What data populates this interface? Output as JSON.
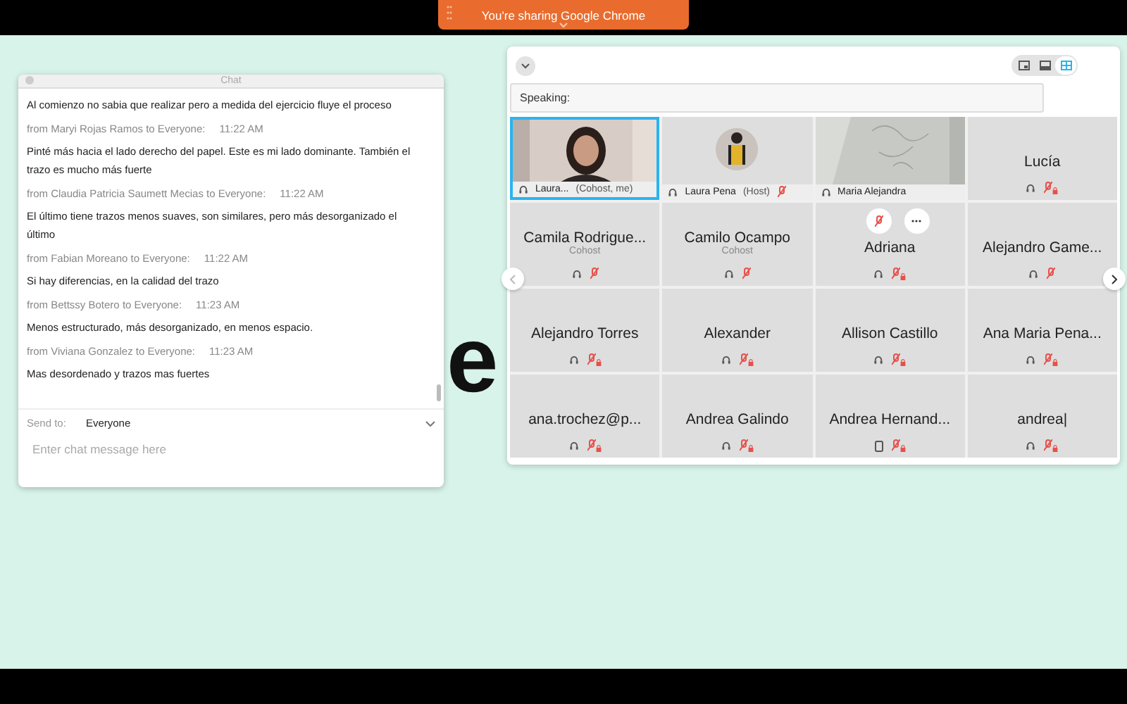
{
  "share_banner": {
    "text": "You're sharing Google Chrome"
  },
  "slide": {
    "text": "e"
  },
  "chat": {
    "title": "Chat",
    "messages": [
      {
        "text": "Al comienzo no sabia que realizar pero a medida del ejercicio fluye el proceso"
      },
      {
        "sender": "from Maryi Rojas Ramos to Everyone:",
        "time": "11:22  AM",
        "text": "Pinté más hacia el lado derecho del papel. Este es mi lado dominante. También el trazo es mucho más fuerte"
      },
      {
        "sender": "from Claudia Patricia Saumett Mecias to Everyone:",
        "time": "11:22  AM",
        "text": "El último tiene trazos menos suaves, son similares, pero más desorganizado el último"
      },
      {
        "sender": "from Fabian Moreano to Everyone:",
        "time": "11:22  AM",
        "text": "Si hay diferencias, en la calidad del trazo"
      },
      {
        "sender": "from Bettssy Botero to Everyone:",
        "time": "11:23  AM",
        "text": "Menos  estructurado, más desorganizado, en menos espacio."
      },
      {
        "sender": "from Viviana Gonzalez to Everyone:",
        "time": "11:23  AM",
        "text": "Mas desordenado y trazos mas fuertes"
      }
    ],
    "send_to_label": "Send to:",
    "send_to_value": "Everyone",
    "placeholder": "Enter chat message here"
  },
  "meeting": {
    "view_modes": [
      {
        "kind": "speaker",
        "selected": false
      },
      {
        "kind": "filmstrip",
        "selected": false
      },
      {
        "kind": "grid",
        "selected": true
      }
    ],
    "speaking_label": "Speaking:",
    "tiles": [
      {
        "kind": "video",
        "name": "Laura...",
        "role": "(Cohost, me)",
        "on_phone": false,
        "muted": false,
        "mute_locked": false,
        "selected": true,
        "hovered": false
      },
      {
        "kind": "avatar",
        "name": "Laura Pena",
        "role": "(Host)",
        "on_phone": false,
        "muted": true,
        "mute_locked": false,
        "selected": false,
        "hovered": false
      },
      {
        "kind": "board",
        "name": "Maria Alejandra",
        "on_phone": false,
        "muted": false,
        "mute_locked": false,
        "selected": false,
        "hovered": false
      },
      {
        "kind": "name",
        "name": "Lucía",
        "on_phone": false,
        "muted": true,
        "mute_locked": true,
        "selected": false,
        "hovered": false
      },
      {
        "kind": "name",
        "name": "Camila Rodrigue...",
        "role": "Cohost",
        "on_phone": false,
        "muted": true,
        "mute_locked": false,
        "selected": false,
        "hovered": false
      },
      {
        "kind": "name",
        "name": "Camilo Ocampo",
        "role": "Cohost",
        "on_phone": false,
        "muted": true,
        "mute_locked": false,
        "selected": false,
        "hovered": false
      },
      {
        "kind": "name",
        "name": "Adriana",
        "on_phone": false,
        "muted": true,
        "mute_locked": true,
        "selected": false,
        "hovered": true
      },
      {
        "kind": "name",
        "name": "Alejandro Game...",
        "on_phone": false,
        "muted": true,
        "mute_locked": false,
        "selected": false,
        "hovered": false
      },
      {
        "kind": "name",
        "name": "Alejandro Torres",
        "on_phone": false,
        "muted": true,
        "mute_locked": true,
        "selected": false,
        "hovered": false
      },
      {
        "kind": "name",
        "name": "Alexander",
        "on_phone": false,
        "muted": true,
        "mute_locked": true,
        "selected": false,
        "hovered": false
      },
      {
        "kind": "name",
        "name": "Allison Castillo",
        "on_phone": false,
        "muted": true,
        "mute_locked": true,
        "selected": false,
        "hovered": false
      },
      {
        "kind": "name",
        "name": "Ana Maria Pena...",
        "on_phone": false,
        "muted": true,
        "mute_locked": true,
        "selected": false,
        "hovered": false
      },
      {
        "kind": "name",
        "name": "ana.trochez@p...",
        "on_phone": false,
        "muted": true,
        "mute_locked": true,
        "selected": false,
        "hovered": false
      },
      {
        "kind": "name",
        "name": "Andrea Galindo",
        "on_phone": false,
        "muted": true,
        "mute_locked": true,
        "selected": false,
        "hovered": false
      },
      {
        "kind": "name",
        "name": "Andrea Hernand...",
        "on_phone": true,
        "muted": true,
        "mute_locked": true,
        "selected": false,
        "hovered": false
      },
      {
        "kind": "name",
        "name": "andrea|",
        "on_phone": false,
        "muted": true,
        "mute_locked": true,
        "selected": false,
        "hovered": false
      }
    ]
  }
}
